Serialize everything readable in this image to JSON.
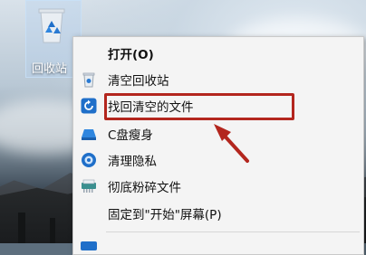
{
  "desktop": {
    "icon_label": "回收站"
  },
  "menu": {
    "items": [
      {
        "label": "打开(O)",
        "icon": "none",
        "bold": true
      },
      {
        "label": "清空回收站",
        "icon": "recycle-bin-icon"
      },
      {
        "label": "找回清空的文件",
        "icon": "restore-icon"
      },
      {
        "label": "C盘瘦身",
        "icon": "drive-icon"
      },
      {
        "label": "清理隐私",
        "icon": "privacy-icon"
      },
      {
        "label": "彻底粉碎文件",
        "icon": "shredder-icon"
      },
      {
        "label": "固定到\"开始\"屏幕(P)",
        "icon": "none"
      }
    ]
  },
  "colors": {
    "highlight": "#b3261e",
    "accent_blue": "#1f6fc9"
  }
}
